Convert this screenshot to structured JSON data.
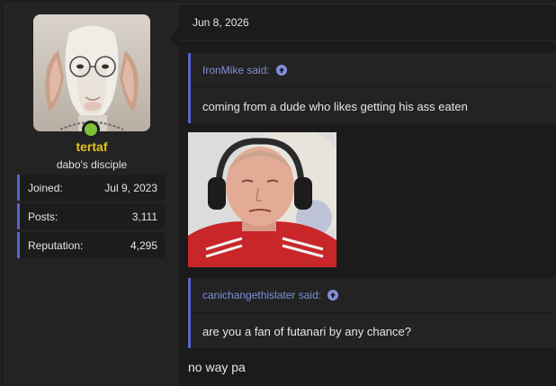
{
  "user": {
    "username": "tertaf",
    "title": "dabo's disciple",
    "online_color": "#7ec03a",
    "stats": [
      {
        "label": "Joined:",
        "value": "Jul 9, 2023"
      },
      {
        "label": "Posts:",
        "value": "3,111"
      },
      {
        "label": "Reputation:",
        "value": "4,295"
      }
    ]
  },
  "post": {
    "date": "Jun 8, 2026",
    "quotes": [
      {
        "author_said": "IronMike said:",
        "text": "coming from a dude who likes getting his ass eaten"
      },
      {
        "author_said": "canichangethislater said:",
        "text": "are you a fan of futanari by any chance?"
      }
    ],
    "reply_text": "no way pa"
  },
  "colors": {
    "accent": "#5865c7",
    "quote_link": "#7f8fd8",
    "username": "#e6c219"
  }
}
